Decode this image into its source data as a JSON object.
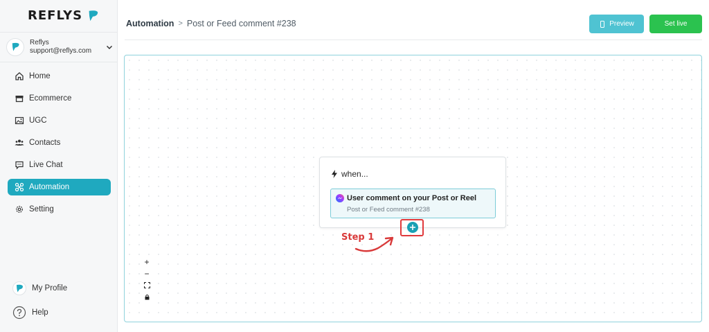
{
  "brand": {
    "name": "REFLYS",
    "accent": "#1fa9bf"
  },
  "account": {
    "name": "Reflys",
    "email": "support@reflys.com"
  },
  "nav": [
    {
      "label": "Home",
      "icon": "home-icon"
    },
    {
      "label": "Ecommerce",
      "icon": "store-icon"
    },
    {
      "label": "UGC",
      "icon": "image-icon"
    },
    {
      "label": "Contacts",
      "icon": "users-icon"
    },
    {
      "label": "Live Chat",
      "icon": "chat-icon"
    },
    {
      "label": "Automation",
      "icon": "automation-icon",
      "active": true
    },
    {
      "label": "Setting",
      "icon": "gear-icon"
    }
  ],
  "bottom": {
    "profile": "My Profile",
    "help": "Help"
  },
  "header": {
    "breadcrumb_root": "Automation",
    "breadcrumb_sep": ">",
    "breadcrumb_current": "Post or Feed comment #238",
    "preview_label": "Preview",
    "set_live_label": "Set live",
    "preview_color": "#4fc3d2",
    "set_live_color": "#2bc24f"
  },
  "flow": {
    "when_label": "when...",
    "trigger_title": "User comment on your Post or Reel",
    "trigger_subtitle": "Post or Feed comment #238"
  },
  "annotation": {
    "step_label": "Step 1",
    "color": "#d93a3a"
  },
  "zoom_controls": [
    "+",
    "−"
  ]
}
